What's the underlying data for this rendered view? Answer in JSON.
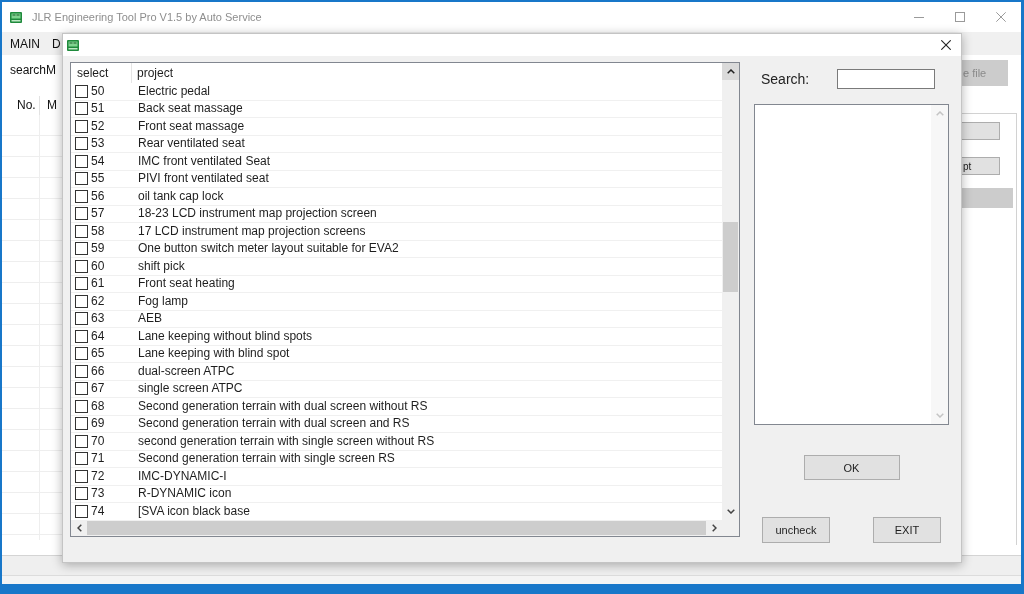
{
  "main_window": {
    "title": "JLR Engineering Tool Pro V1.5 by Auto Service",
    "menu": [
      {
        "label": "MAIN"
      },
      {
        "label": "D"
      }
    ],
    "search_label": "searchM",
    "table_columns": [
      "No.",
      "M"
    ],
    "side_buttons": [
      {
        "label": "e file"
      },
      {
        "label": "pt"
      }
    ]
  },
  "dialog": {
    "columns": [
      "select",
      "project"
    ],
    "rows": [
      {
        "number": "50",
        "project": "Electric pedal",
        "checked": false
      },
      {
        "number": "51",
        "project": "Back seat massage",
        "checked": false
      },
      {
        "number": "52",
        "project": "Front seat massage",
        "checked": false
      },
      {
        "number": "53",
        "project": "Rear ventilated seat",
        "checked": false
      },
      {
        "number": "54",
        "project": "IMC front ventilated Seat",
        "checked": false
      },
      {
        "number": "55",
        "project": "PIVI front ventilated seat",
        "checked": false
      },
      {
        "number": "56",
        "project": "oil tank cap lock",
        "checked": false
      },
      {
        "number": "57",
        "project": "18-23 LCD instrument map projection screen",
        "checked": false
      },
      {
        "number": "58",
        "project": "17 LCD instrument map projection screens",
        "checked": false
      },
      {
        "number": "59",
        "project": "One button switch meter layout suitable for EVA2",
        "checked": false
      },
      {
        "number": "60",
        "project": "shift pick",
        "checked": false
      },
      {
        "number": "61",
        "project": "Front seat heating",
        "checked": false
      },
      {
        "number": "62",
        "project": "Fog lamp",
        "checked": false
      },
      {
        "number": "63",
        "project": "AEB",
        "checked": false
      },
      {
        "number": "64",
        "project": "Lane keeping without blind spots",
        "checked": false
      },
      {
        "number": "65",
        "project": "Lane keeping with blind spot",
        "checked": false
      },
      {
        "number": "66",
        "project": "dual-screen ATPC",
        "checked": false
      },
      {
        "number": "67",
        "project": "single screen ATPC",
        "checked": false
      },
      {
        "number": "68",
        "project": "Second generation terrain with dual screen without RS",
        "checked": false
      },
      {
        "number": "69",
        "project": "Second generation terrain with dual screen and RS",
        "checked": false
      },
      {
        "number": "70",
        "project": "second generation terrain with single screen without RS",
        "checked": false
      },
      {
        "number": "71",
        "project": "Second generation terrain with single screen RS",
        "checked": false
      },
      {
        "number": "72",
        "project": "IMC-DYNAMIC-I",
        "checked": false
      },
      {
        "number": "73",
        "project": "R-DYNAMIC icon",
        "checked": false
      },
      {
        "number": "74",
        "project": "[SVA icon black base",
        "checked": false
      }
    ],
    "search": {
      "label": "Search:"
    },
    "ok_button": {
      "label": "OK"
    },
    "footer_buttons": [
      {
        "label": "uncheck"
      },
      {
        "label": "EXIT"
      }
    ]
  }
}
